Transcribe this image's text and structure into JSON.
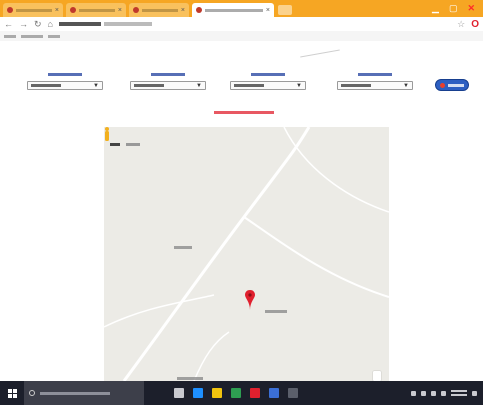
{
  "browser": {
    "tab_titles": [
      "",
      "",
      "",
      ""
    ],
    "active_tab_title": "",
    "url": "",
    "bookmark_labels": []
  },
  "page": {
    "filters": [
      {
        "label": "",
        "selected": ""
      },
      {
        "label": "",
        "selected": ""
      },
      {
        "label": "",
        "selected": ""
      },
      {
        "label": "",
        "selected": ""
      }
    ],
    "go_button_label": "",
    "status_message": "",
    "status_color": "#e0202e",
    "accent_color": "#2d5fc2"
  },
  "map": {
    "type_control_labels": [
      "",
      ""
    ],
    "place_labels": [
      "",
      "",
      ""
    ],
    "marker_icon": "map-pin-icon",
    "marker_color": "#e0202e"
  },
  "taskbar": {
    "search_placeholder": "",
    "clock_time": "",
    "clock_date": ""
  }
}
